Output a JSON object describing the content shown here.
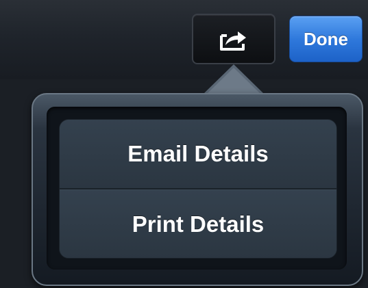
{
  "toolbar": {
    "share_icon": "share-icon",
    "done_label": "Done"
  },
  "popover": {
    "items": [
      {
        "label": "Email Details"
      },
      {
        "label": "Print Details"
      }
    ]
  },
  "colors": {
    "done_button": "#2f79dc",
    "toolbar_bg": "#1f242b",
    "menu_bg": "#2b3641",
    "popover_border": "#6b7885"
  }
}
